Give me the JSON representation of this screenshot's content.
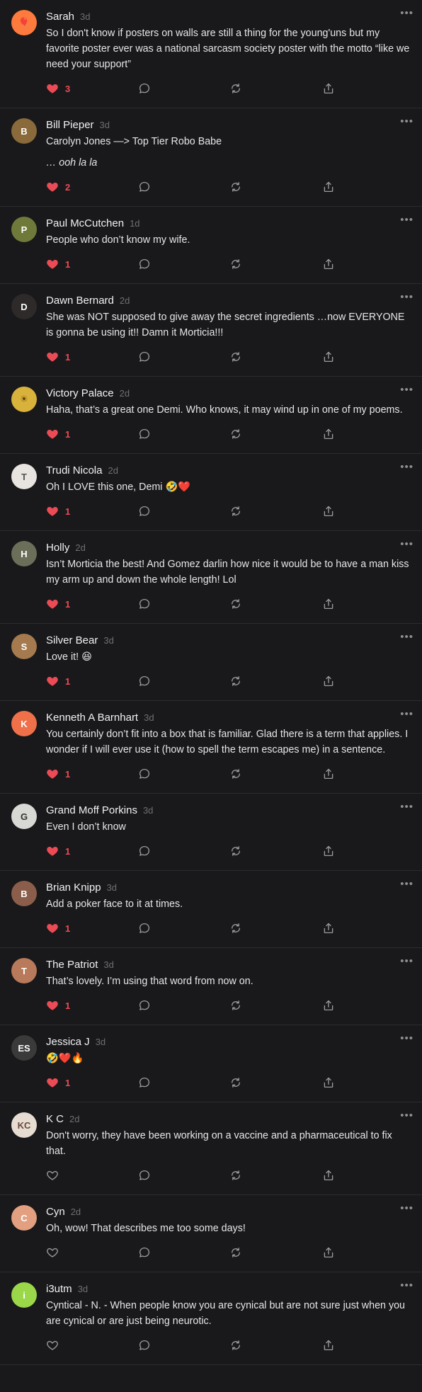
{
  "posts": [
    {
      "name": "Sarah",
      "time": "3d",
      "text": "So I don't know if posters on walls are still a thing for the young'uns but my favorite poster ever was a national sarcasm society poster with the motto “like we need your support”",
      "likes": "3",
      "liked": true,
      "avatar": {
        "bg": "#ff7a3d",
        "fg": "#ffffff",
        "initial": "🎈"
      }
    },
    {
      "name": "Bill Pieper",
      "time": "3d",
      "text": "Carolyn Jones —> Top Tier Robo Babe",
      "text2": "… ooh la la",
      "likes": "2",
      "liked": true,
      "avatar": {
        "bg": "#8a6a3b",
        "fg": "#ffffff",
        "initial": "B"
      }
    },
    {
      "name": "Paul McCutchen",
      "time": "1d",
      "text": "People who don’t know my wife.",
      "likes": "1",
      "liked": true,
      "avatar": {
        "bg": "#6f7a3a",
        "fg": "#ffffff",
        "initial": "P"
      }
    },
    {
      "name": "Dawn Bernard",
      "time": "2d",
      "text": "She was NOT supposed to give away the secret ingredients …now EVERYONE is gonna be using it!! Damn it Morticia!!!",
      "likes": "1",
      "liked": true,
      "avatar": {
        "bg": "#2e2a2a",
        "fg": "#ffffff",
        "initial": "D"
      }
    },
    {
      "name": "Victory Palace",
      "time": "2d",
      "text": "Haha, that’s a great one Demi. Who knows, it may wind up in one of my poems.",
      "likes": "1",
      "liked": true,
      "avatar": {
        "bg": "#d9b23c",
        "fg": "#5a3d00",
        "initial": "☀"
      }
    },
    {
      "name": "Trudi Nicola",
      "time": "2d",
      "text": "Oh I LOVE this one, Demi 🤣❤️",
      "likes": "1",
      "liked": true,
      "avatar": {
        "bg": "#e8e4e0",
        "fg": "#555555",
        "initial": "T"
      }
    },
    {
      "name": "Holly",
      "time": "2d",
      "text": "Isn’t Morticia the best! And Gomez darlin how nice it would be to have a man kiss my arm up and down the whole length! Lol",
      "likes": "1",
      "liked": true,
      "avatar": {
        "bg": "#6b6f5a",
        "fg": "#ffffff",
        "initial": "H"
      }
    },
    {
      "name": "Silver Bear",
      "time": "3d",
      "text": "Love it! 😆",
      "likes": "1",
      "liked": true,
      "avatar": {
        "bg": "#a47a4e",
        "fg": "#ffffff",
        "initial": "S"
      }
    },
    {
      "name": "Kenneth A Barnhart",
      "time": "3d",
      "text": "You certainly don’t fit into a box that is familiar. Glad there is a term that applies. I wonder if I will ever use it (how to spell the term escapes me) in a sentence.",
      "likes": "1",
      "liked": true,
      "avatar": {
        "bg": "#f0704a",
        "fg": "#ffffff",
        "initial": "K"
      }
    },
    {
      "name": "Grand Moff Porkins",
      "time": "3d",
      "text": "Even I don’t know",
      "likes": "1",
      "liked": true,
      "avatar": {
        "bg": "#d8d8d4",
        "fg": "#333333",
        "initial": "G"
      }
    },
    {
      "name": "Brian Knipp",
      "time": "3d",
      "text": "Add a poker face to it at times.",
      "likes": "1",
      "liked": true,
      "avatar": {
        "bg": "#8a5e4a",
        "fg": "#ffffff",
        "initial": "B"
      }
    },
    {
      "name": "The Patriot",
      "time": "3d",
      "text": "That’s lovely. I’m using that word from now on.",
      "likes": "1",
      "liked": true,
      "avatar": {
        "bg": "#b87a5a",
        "fg": "#ffffff",
        "initial": "T"
      }
    },
    {
      "name": "Jessica J",
      "time": "3d",
      "text": "🤣❤️🔥",
      "likes": "1",
      "liked": true,
      "avatar": {
        "bg": "#3a3a3a",
        "fg": "#ffffff",
        "initial": "ES"
      }
    },
    {
      "name": "K C",
      "time": "2d",
      "text": "Don't worry, they have been working on a vaccine and a pharmaceutical to fix that.",
      "likes": "",
      "liked": false,
      "avatar": {
        "bg": "#e6dcd2",
        "fg": "#6a4a3a",
        "initial": "KC"
      }
    },
    {
      "name": "Cyn",
      "time": "2d",
      "text": "Oh, wow! That describes me too some days!",
      "likes": "",
      "liked": false,
      "avatar": {
        "bg": "#e2a080",
        "fg": "#ffffff",
        "initial": "C"
      }
    },
    {
      "name": "i3utm",
      "time": "3d",
      "text": "Cyntical - N. - When people know you are cynical but are not sure just when you are cynical or are just being neurotic.",
      "likes": "",
      "liked": false,
      "avatar": {
        "bg": "#9ad84a",
        "fg": "#ffffff",
        "initial": "i"
      }
    }
  ],
  "icons": {
    "like": "heart-icon",
    "reply": "reply-icon",
    "repost": "repost-icon",
    "share": "share-icon",
    "more": "more-icon"
  },
  "colors": {
    "like": "#ec4b55",
    "icon": "#9a9aa0",
    "background": "#19191b"
  }
}
